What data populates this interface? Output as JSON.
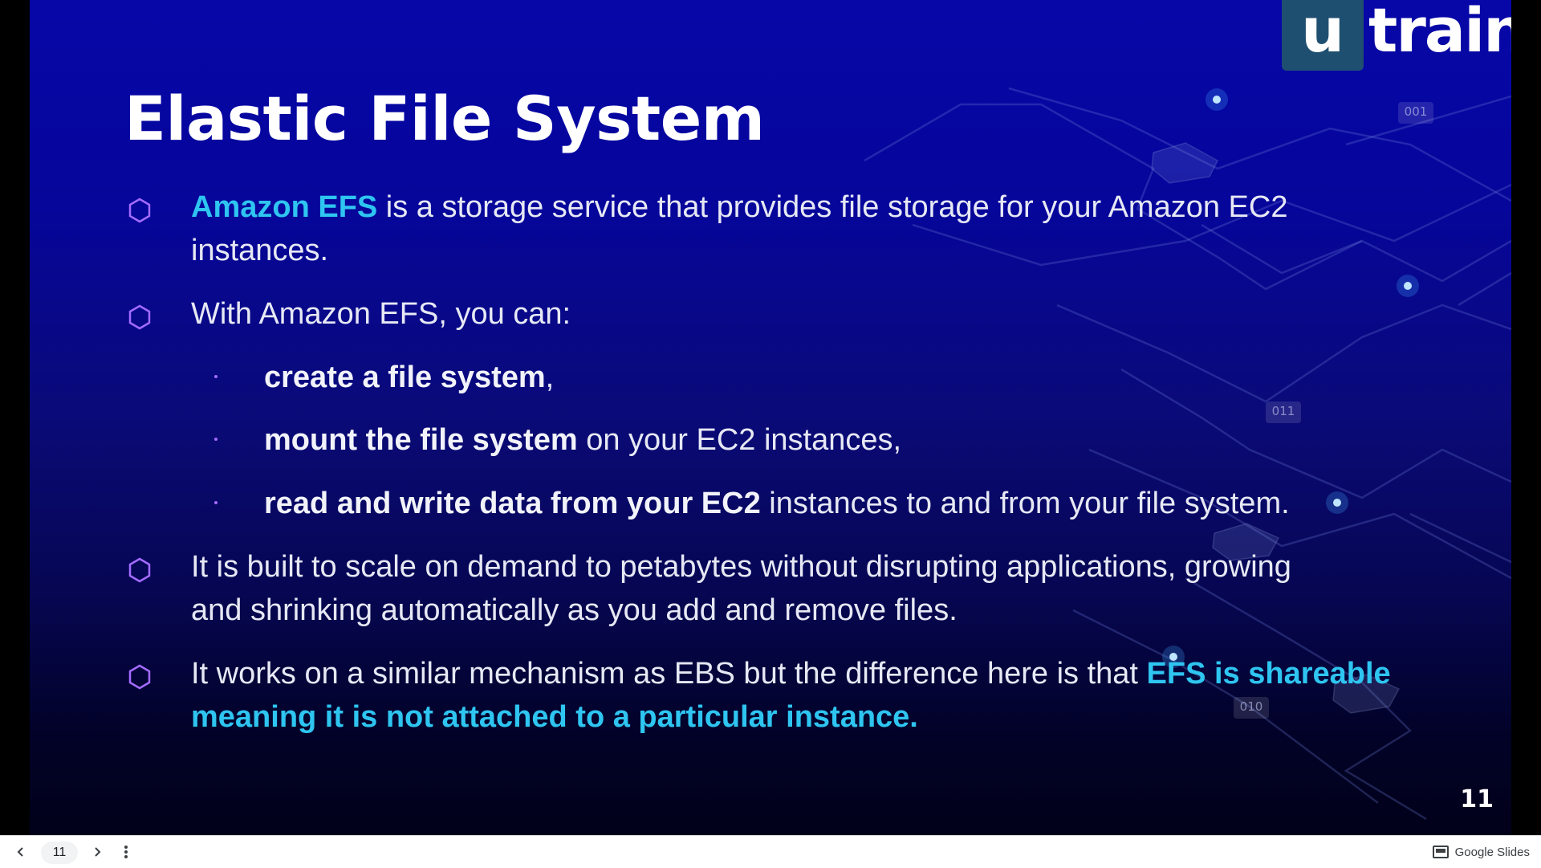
{
  "slide": {
    "logo": {
      "box_letter": "u",
      "word": "train"
    },
    "title": "Elastic File System",
    "bullets": [
      {
        "highlight": "Amazon EFS",
        "rest": " is a storage service that provides file storage for your Amazon EC2",
        "line2": "instances."
      },
      {
        "text": "With Amazon EFS, you can:"
      },
      {
        "line1": "It is built to scale on demand to petabytes without disrupting applications, growing",
        "line2": "and shrinking automatically as you add and remove files."
      },
      {
        "text": "It works on a similar mechanism as EBS but the difference here is that ",
        "highlight1": "EFS is shareable",
        "highlight2": "meaning it is not attached to a particular instance."
      }
    ],
    "subitems": [
      {
        "bold": "create a file system",
        "rest": ","
      },
      {
        "bold": "mount the file system",
        "rest": " on your EC2 instances,"
      },
      {
        "bold": "read and write data from your EC2",
        "rest": " instances to and from your file system."
      }
    ],
    "deco_labels": [
      "001",
      "011",
      "010"
    ],
    "page_number": "11",
    "colors": {
      "highlight": "#2ec5f0",
      "bullet_marker": "#a36bff",
      "logo_box": "#1f4f70"
    }
  },
  "toolbar": {
    "prev_icon": "chevron-left-icon",
    "next_icon": "chevron-right-icon",
    "more_icon": "more-vert-icon",
    "current_page": "11",
    "brand": "Google Slides"
  }
}
